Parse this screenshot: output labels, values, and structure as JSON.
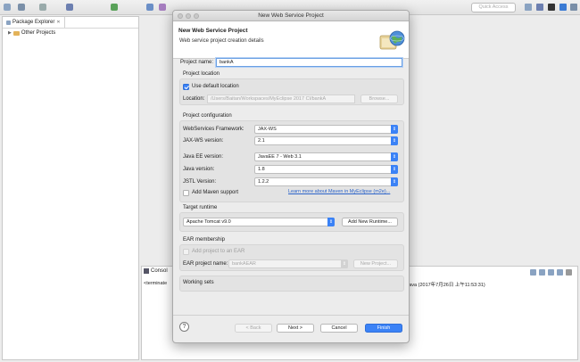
{
  "toolbar": {
    "quick_access_placeholder": "Quick Access"
  },
  "explorer": {
    "tab_label": "Package Explorer",
    "tree": [
      {
        "label": "Other Projects"
      }
    ]
  },
  "console": {
    "tab_label": "Consol",
    "line1": "<terminate",
    "line2": "java (2017年7月26日 上午11:53:31)"
  },
  "dialog": {
    "window_title": "New Web Service Project",
    "banner_title": "New Web Service Project",
    "banner_description": "Web service project creation details",
    "project_name_label": "Project name:",
    "project_name_value": "bankA",
    "project_location": {
      "group_title": "Project location",
      "use_default_label": "Use default location",
      "use_default_checked": true,
      "location_label": "Location:",
      "location_value": "/Users/Baitan/Workspaces/MyEclipse 2017 CI/bankA",
      "browse_label": "Browse..."
    },
    "project_configuration": {
      "group_title": "Project configuration",
      "ws_framework_label": "WebServices Framework:",
      "ws_framework_value": "JAX-WS",
      "jaxws_version_label": "JAX-WS version:",
      "jaxws_version_value": "2.1",
      "javaee_version_label": "Java EE version:",
      "javaee_version_value": "JavaEE 7 - Web 3.1",
      "java_version_label": "Java version:",
      "java_version_value": "1.8",
      "jstl_version_label": "JSTL Version:",
      "jstl_version_value": "1.2.2",
      "maven_label": "Add Maven support",
      "maven_checked": false,
      "maven_link": "Learn more about Maven in MyEclipse (m2e)..."
    },
    "target_runtime": {
      "group_title": "Target runtime",
      "runtime_value": "Apache Tomcat v9.0",
      "new_runtime_label": "Add New Runtime..."
    },
    "ear_membership": {
      "group_title": "EAR membership",
      "add_to_ear_label": "Add project to an EAR",
      "add_to_ear_checked": false,
      "ear_name_label": "EAR project name:",
      "ear_name_value": "bankAEAR",
      "new_project_label": "New Project..."
    },
    "working_sets": {
      "group_title": "Working sets"
    },
    "footer": {
      "help_label": "?",
      "back_label": "< Back",
      "next_label": "Next >",
      "cancel_label": "Cancel",
      "finish_label": "Finish"
    }
  }
}
